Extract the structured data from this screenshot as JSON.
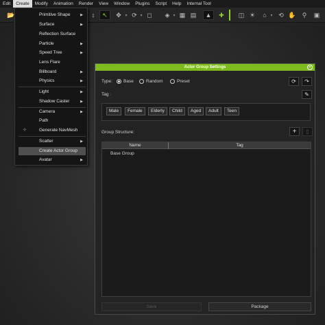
{
  "menubar": {
    "items": [
      "Edit",
      "Create",
      "Modify",
      "Animation",
      "Render",
      "View",
      "Window",
      "Plugins",
      "Script",
      "Help",
      "Internal Tool"
    ],
    "active_index": 1
  },
  "create_menu": {
    "items": [
      {
        "label": "Primitive Shape",
        "submenu": true
      },
      {
        "label": "Surface",
        "submenu": true
      },
      {
        "label": "Reflection Surface",
        "submenu": false
      },
      {
        "label": "Particle",
        "submenu": true
      },
      {
        "label": "Speed Tree",
        "submenu": true
      },
      {
        "label": "Lens Flare",
        "submenu": false
      },
      {
        "label": "Billboard",
        "submenu": true
      },
      {
        "label": "Physics",
        "submenu": true
      },
      {
        "label": "Light",
        "submenu": true
      },
      {
        "label": "Shadow Caster",
        "submenu": true
      },
      {
        "label": "Camera",
        "submenu": true
      },
      {
        "label": "Path",
        "submenu": false
      },
      {
        "label": "Generate NavMesh",
        "submenu": false,
        "icon": "navmesh-icon"
      },
      {
        "label": "Scatter",
        "submenu": true
      },
      {
        "label": "Create Actor Group",
        "submenu": false,
        "highlighted": true
      },
      {
        "label": "Avatar",
        "submenu": true
      }
    ]
  },
  "dialog": {
    "title": "Actor Group Settings",
    "type_label": "Type:",
    "type_options": [
      "Base",
      "Random",
      "Preset"
    ],
    "type_selected": "Base",
    "tag_label": "Tag :",
    "tags": [
      "Male",
      "Female",
      "Elderly",
      "Child",
      "Aged",
      "Adult",
      "Teen"
    ],
    "group_structure_label": "Group Structure:",
    "columns": [
      "Name",
      "Tag"
    ],
    "rows": [
      {
        "name": "Base Group",
        "tag": ""
      }
    ],
    "save_label": "Save",
    "package_label": "Package"
  },
  "colors": {
    "accent": "#7dbb1f",
    "menu_bg": "#151515",
    "dialog_bg": "#232323"
  }
}
